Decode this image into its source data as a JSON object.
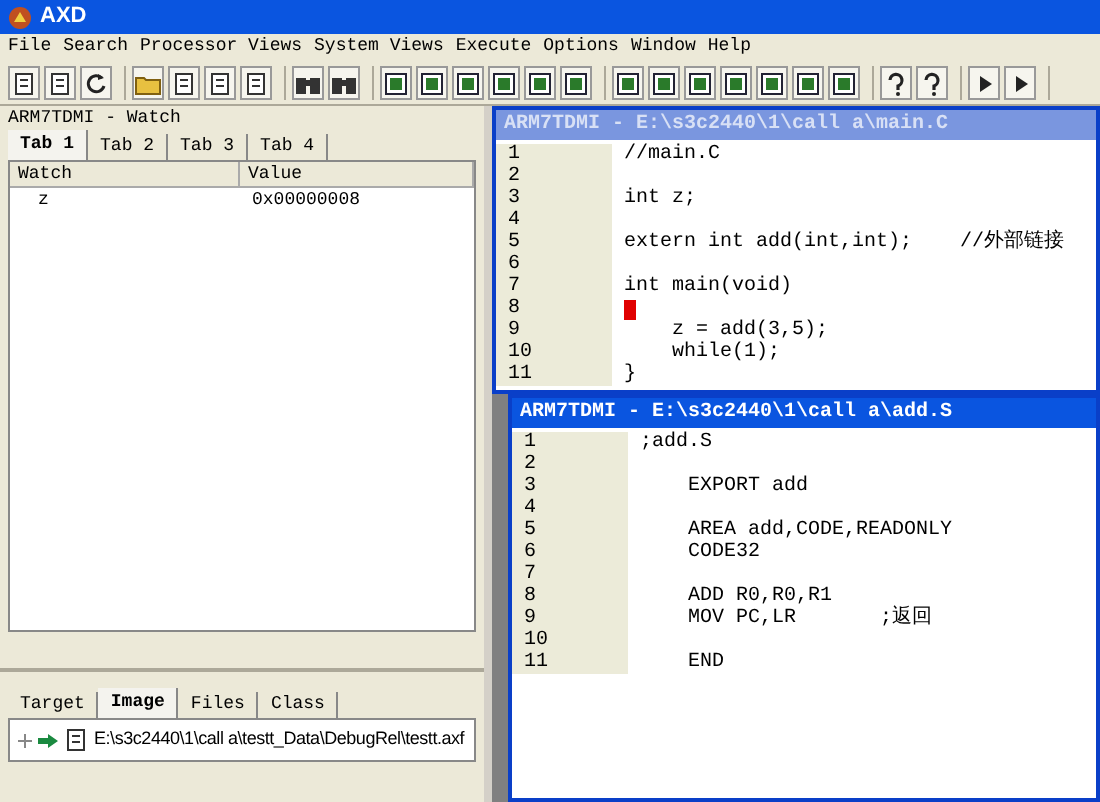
{
  "window": {
    "title": "AXD"
  },
  "menu": [
    "File",
    "Search",
    "Processor Views",
    "System Views",
    "Execute",
    "Options",
    "Window",
    "Help"
  ],
  "watch_panel": {
    "title": "ARM7TDMI - Watch",
    "tabs": [
      {
        "label": "Tab 1",
        "selected": true
      },
      {
        "label": "Tab 2",
        "selected": false
      },
      {
        "label": "Tab 3",
        "selected": false
      },
      {
        "label": "Tab 4",
        "selected": false
      }
    ],
    "columns": [
      "Watch",
      "Value"
    ],
    "rows": [
      {
        "name": "z",
        "value": "0x00000008"
      }
    ]
  },
  "project_panel": {
    "tabs": [
      {
        "label": "Target",
        "selected": false
      },
      {
        "label": "Image",
        "selected": true
      },
      {
        "label": "Files",
        "selected": false
      },
      {
        "label": "Class",
        "selected": false
      }
    ],
    "items": [
      {
        "label": "E:\\s3c2440\\1\\call a\\testt_Data\\DebugRel\\testt.axf"
      }
    ]
  },
  "editors": [
    {
      "title": "ARM7TDMI - E:\\s3c2440\\1\\call a\\main.C",
      "active": false,
      "lines": [
        {
          "number": "1",
          "code": "//main.C",
          "breakpoint": false
        },
        {
          "number": "2",
          "breakpoint": false
        },
        {
          "number": "3",
          "code": "int z;",
          "breakpoint": false
        },
        {
          "number": "4",
          "breakpoint": false
        },
        {
          "number": "5",
          "code": "extern int add(int,int);    //外部链接",
          "breakpoint": false
        },
        {
          "number": "6",
          "breakpoint": false
        },
        {
          "number": "7",
          "code": "int main(void)",
          "breakpoint": false
        },
        {
          "number": "8",
          "breakpoint": true
        },
        {
          "number": "9",
          "code": "    z = add(3,5);",
          "breakpoint": false
        },
        {
          "number": "10",
          "code": "    while(1);",
          "breakpoint": false
        },
        {
          "number": "11",
          "code": "}",
          "breakpoint": false
        }
      ]
    },
    {
      "title": "ARM7TDMI - E:\\s3c2440\\1\\call a\\add.S",
      "active": true,
      "lines": [
        {
          "number": "1",
          "code": ";add.S",
          "breakpoint": false
        },
        {
          "number": "2",
          "breakpoint": false
        },
        {
          "number": "3",
          "code": "    EXPORT add",
          "breakpoint": false
        },
        {
          "number": "4",
          "breakpoint": false
        },
        {
          "number": "5",
          "code": "    AREA add,CODE,READONLY",
          "breakpoint": false
        },
        {
          "number": "6",
          "code": "    CODE32",
          "breakpoint": false
        },
        {
          "number": "7",
          "breakpoint": false
        },
        {
          "number": "8",
          "code": "    ADD R0,R0,R1",
          "breakpoint": false
        },
        {
          "number": "9",
          "code": "    MOV PC,LR       ;返回",
          "breakpoint": false
        },
        {
          "number": "10",
          "breakpoint": false
        },
        {
          "number": "11",
          "code": "    END",
          "breakpoint": false
        }
      ]
    }
  ]
}
